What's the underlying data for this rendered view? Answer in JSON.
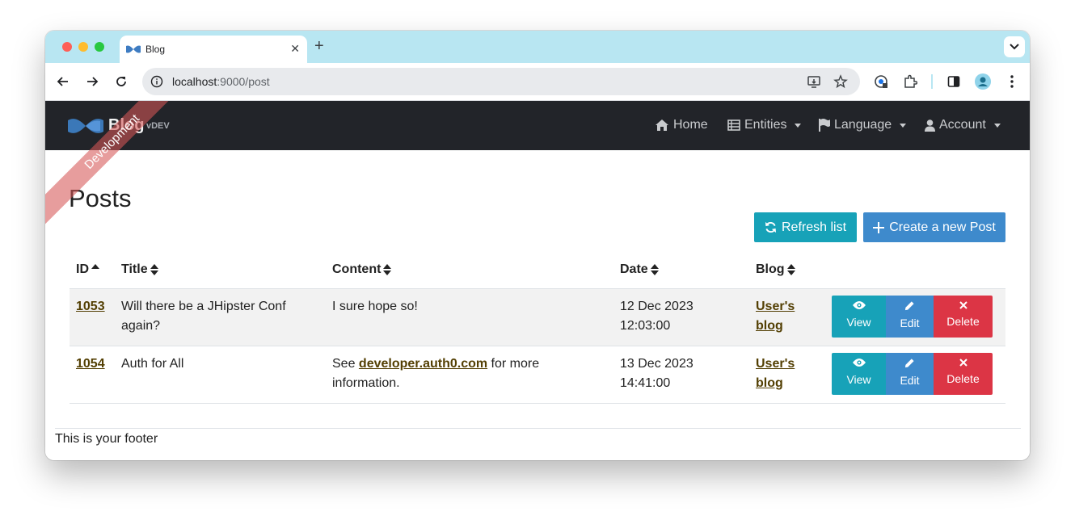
{
  "browser": {
    "tab_title": "Blog",
    "url_host": "localhost",
    "url_path": ":9000/post"
  },
  "navbar": {
    "brand": "Blog",
    "version": "vDEV",
    "items": [
      {
        "label": "Home",
        "icon": "home-icon"
      },
      {
        "label": "Entities",
        "icon": "table-list-icon"
      },
      {
        "label": "Language",
        "icon": "flag-icon"
      },
      {
        "label": "Account",
        "icon": "user-icon"
      }
    ]
  },
  "ribbon": "Development",
  "page": {
    "title": "Posts",
    "refresh_label": "Refresh list",
    "create_label": "Create a new Post"
  },
  "table": {
    "columns": [
      "ID",
      "Title",
      "Content",
      "Date",
      "Blog"
    ],
    "rows": [
      {
        "id": "1053",
        "title": "Will there be a JHipster Conf again?",
        "content_before": "I sure hope so!",
        "content_link": "",
        "content_after": "",
        "date_line1": "12 Dec 2023",
        "date_line2": "12:03:00",
        "blog": "User's blog"
      },
      {
        "id": "1054",
        "title": "Auth for All",
        "content_before": "See ",
        "content_link": "developer.auth0.com",
        "content_after": " for more information.",
        "date_line1": "13 Dec 2023",
        "date_line2": "14:41:00",
        "blog": "User's blog"
      }
    ],
    "actions": {
      "view": "View",
      "edit": "Edit",
      "delete": "Delete"
    }
  },
  "footer": "This is your footer",
  "colors": {
    "navbar_bg": "#222429",
    "tabstrip_bg": "#b8e6f2",
    "info": "#17a2b8",
    "primary": "#3e8acc",
    "danger": "#dc3545",
    "link": "#533f03"
  }
}
